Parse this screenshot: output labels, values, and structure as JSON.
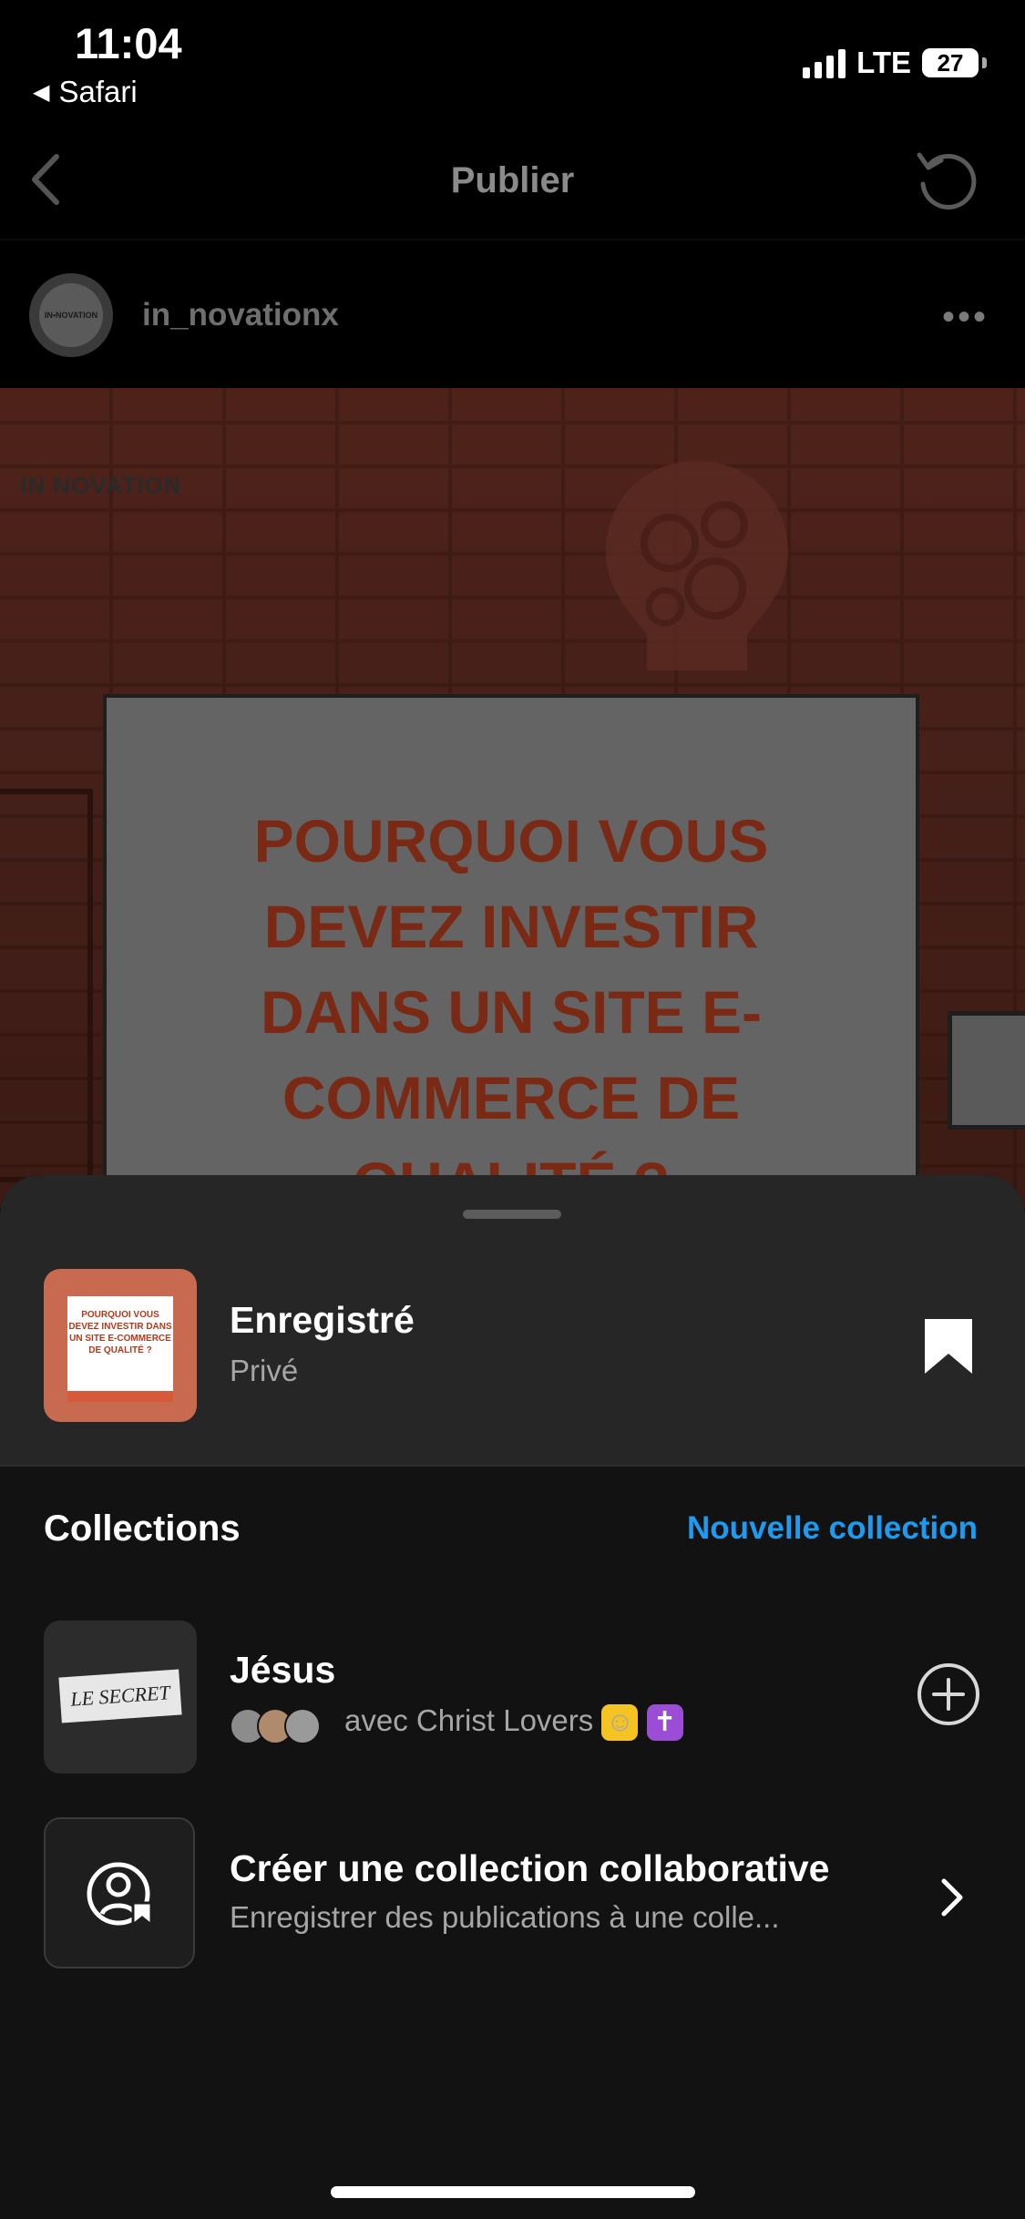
{
  "status_bar": {
    "time": "11:04",
    "back_app": "Safari",
    "network": "LTE",
    "battery": "27"
  },
  "header": {
    "title": "Publier"
  },
  "post": {
    "username": "in_novationx",
    "more": "•••",
    "image_logo": "IN NOVATION",
    "image_headline": "POURQUOI VOUS DEVEZ INVESTIR DANS UN SITE E-COMMERCE DE QUALITÉ ?"
  },
  "sheet": {
    "saved": {
      "title": "Enregistré",
      "subtitle": "Privé",
      "thumb_text": "POURQUOI VOUS DEVEZ INVESTIR DANS UN SITE E-COMMERCE DE QUALITÉ ?"
    },
    "collections_label": "Collections",
    "new_collection": "Nouvelle collection",
    "items": [
      {
        "title": "Jésus",
        "subtitle": "avec Christ Lovers",
        "thumb_text": "LE SECRET"
      },
      {
        "title": "Créer une collection collaborative",
        "subtitle": "Enregistrer des publications à une colle..."
      }
    ]
  },
  "colors": {
    "accent": "#1d9bf0",
    "sheet_bg": "#121212",
    "sheet_top_bg": "#262626"
  }
}
